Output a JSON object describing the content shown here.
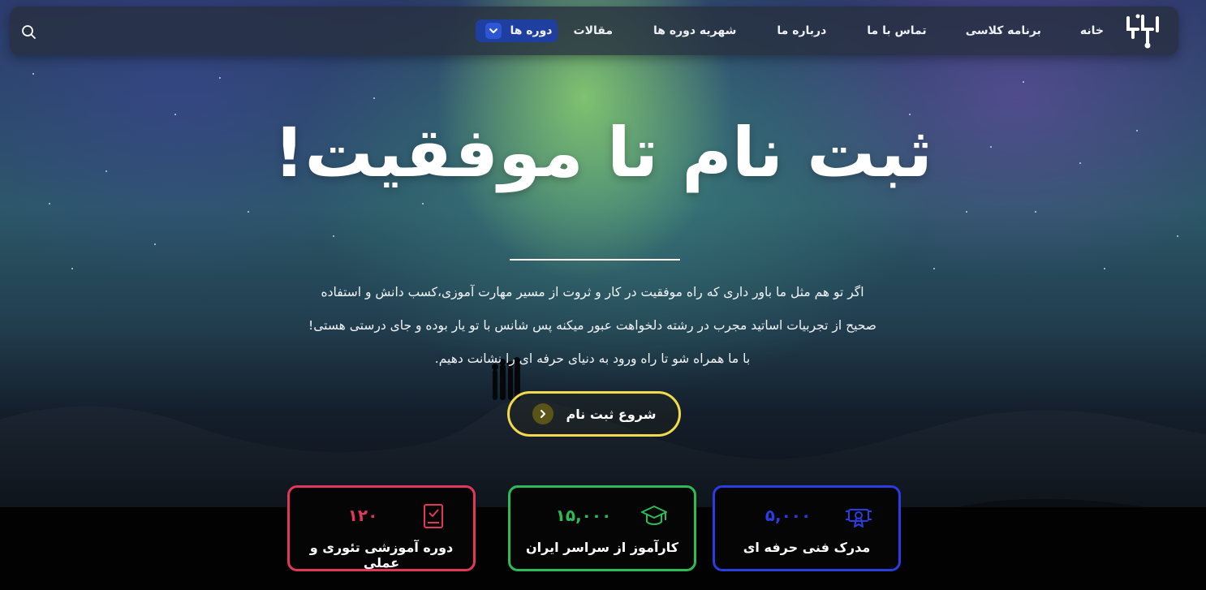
{
  "nav": {
    "items": [
      "خانه",
      "برنامه کلاسی",
      "تماس با ما",
      "درباره ما",
      "شهریه دوره ها",
      "مقالات"
    ],
    "dropdown_label": "دوره ها",
    "search_icon": "search-icon",
    "logo_icon": "circuit-logo-icon",
    "dropdown_icon": "chevron-down-icon"
  },
  "hero": {
    "title": "ثبت نام تا موفقیت!",
    "description": "اگر تو هم مثل ما باور داری که راه موفقیت در کار و ثروت از مسیر مهارت آموزی،کسب دانش و استفاده صحیح از تجربیات اساتید مجرب در رشته دلخواهت عبور میکنه پس شانس با تو یار بوده و جای درستی هستی! با ما همراه شو تا راه ورود به دنیای حرفه ای را نشانت دهیم.",
    "cta_label": "شروع ثبت نام",
    "cta_icon": "chevron-right-icon"
  },
  "stats": [
    {
      "value": "۵,۰۰۰",
      "label": "مدرک فنی حرفه ای",
      "icon": "certificate-icon",
      "color": "#2a3de0"
    },
    {
      "value": "۱۵,۰۰۰",
      "label": "کارآموز از سراسر ایران",
      "icon": "graduation-cap-icon",
      "color": "#2dbb56"
    },
    {
      "value": "۱۲۰",
      "label": "دوره آموزشی تئوری و عملی",
      "icon": "book-check-icon",
      "color": "#e2365b"
    }
  ],
  "colors": {
    "nav_dropdown_bg": "#1f3fa0",
    "cta_border": "#f3da4a"
  }
}
